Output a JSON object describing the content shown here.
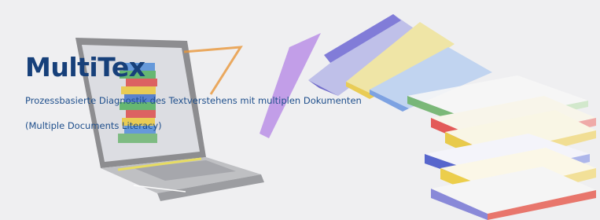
{
  "banner": {
    "title": "MultiTex",
    "subtitle": "Prozessbasierte Diagnostik des Textverstehens mit multiplen Dokumenten",
    "subtitle_secondary": "(Multiple Documents Literacy)",
    "colors": {
      "background": "#efeff1",
      "title": "#17407a",
      "subtitle": "#1f4f8c"
    },
    "illustration_icons": [
      "laptop-icon",
      "flying-books-icon",
      "book-stack-icon"
    ]
  }
}
